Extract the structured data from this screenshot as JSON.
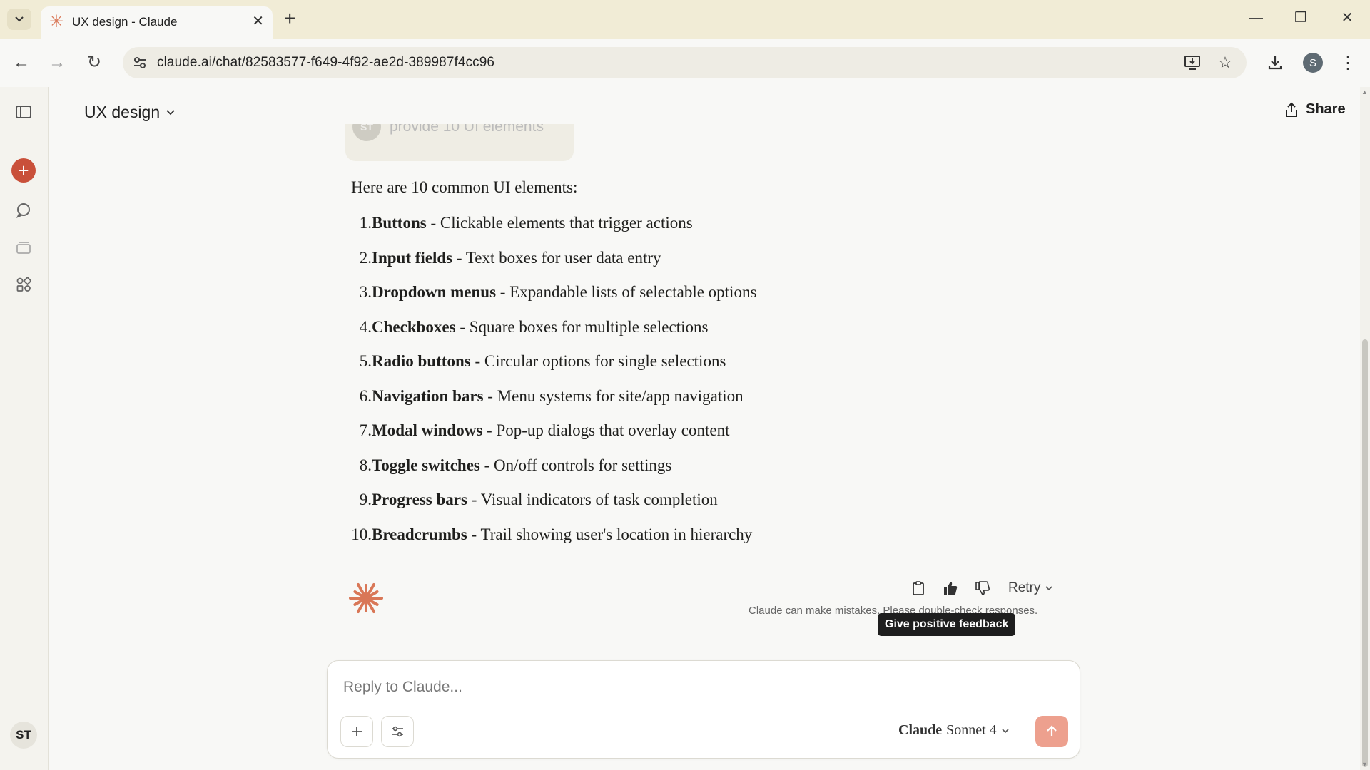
{
  "browser": {
    "tab_title": "UX design - Claude",
    "url": "claude.ai/chat/82583577-f649-4f92-ae2d-389987f4cc96",
    "profile_initial": "S"
  },
  "header": {
    "chat_title": "UX design",
    "share_label": "Share"
  },
  "user_message": {
    "avatar": "ST",
    "text": "provide 10 UI elements"
  },
  "response": {
    "intro": "Here are 10 common UI elements:",
    "items": [
      {
        "num": "1.",
        "term": "Buttons",
        "desc": " - Clickable elements that trigger actions"
      },
      {
        "num": "2.",
        "term": "Input fields",
        "desc": " - Text boxes for user data entry"
      },
      {
        "num": "3.",
        "term": "Dropdown menus",
        "desc": " - Expandable lists of selectable options"
      },
      {
        "num": "4.",
        "term": "Checkboxes",
        "desc": " - Square boxes for multiple selections"
      },
      {
        "num": "5.",
        "term": "Radio buttons",
        "desc": " - Circular options for single selections"
      },
      {
        "num": "6.",
        "term": "Navigation bars",
        "desc": " - Menu systems for site/app navigation"
      },
      {
        "num": "7.",
        "term": "Modal windows",
        "desc": " - Pop-up dialogs that overlay content"
      },
      {
        "num": "8.",
        "term": "Toggle switches",
        "desc": " - On/off controls for settings"
      },
      {
        "num": "9.",
        "term": "Progress bars",
        "desc": " - Visual indicators of task completion"
      },
      {
        "num": "10.",
        "term": "Breadcrumbs",
        "desc": " - Trail showing user's location in hierarchy"
      }
    ],
    "retry_label": "Retry",
    "disclaimer": "Claude can make mistakes. Please double-check responses.",
    "tooltip": "Give positive feedback"
  },
  "composer": {
    "placeholder": "Reply to Claude...",
    "model_brand": "Claude",
    "model_version": "Sonnet 4"
  },
  "sidebar": {
    "avatar": "ST"
  },
  "colors": {
    "accent": "#c9503a",
    "claude_orange": "#d97757",
    "send_button": "#eda08e"
  }
}
